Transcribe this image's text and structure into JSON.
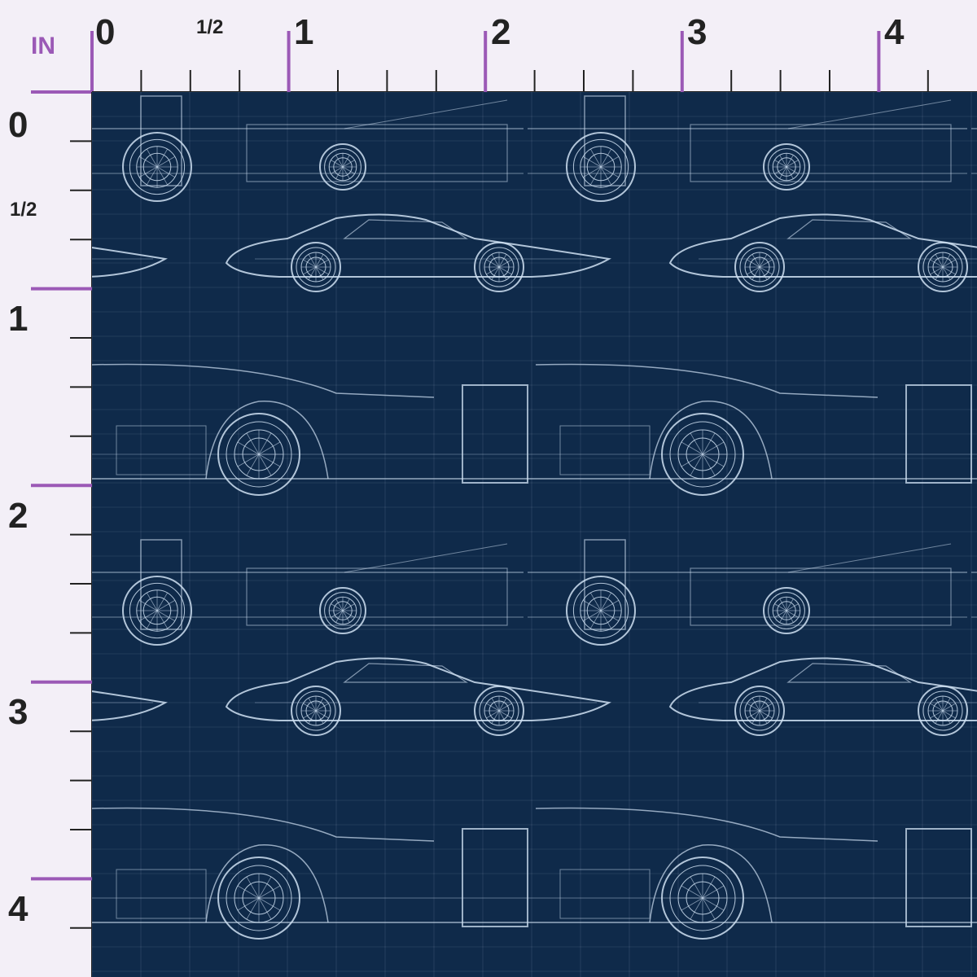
{
  "ruler": {
    "unit_label": "IN",
    "top_labels": [
      "0",
      "1/2",
      "1",
      "2",
      "3",
      "4"
    ],
    "left_labels": [
      "0",
      "1/2",
      "1",
      "2",
      "3",
      "4"
    ]
  },
  "colors": {
    "background": "#f3eff7",
    "accent": "#9b59b6",
    "tick": "#222222",
    "swatch": "#0f2a4a",
    "line": "#cfe0f2"
  },
  "pattern": {
    "description_icon": "car-blueprint-icon"
  }
}
